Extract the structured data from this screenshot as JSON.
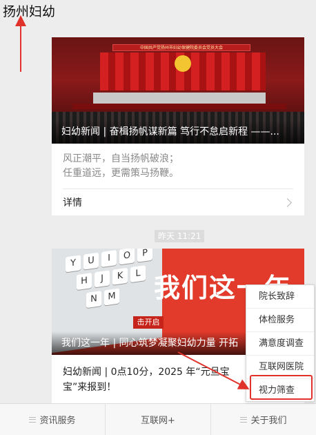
{
  "header": {
    "title": "扬州妇幼"
  },
  "cards": [
    {
      "caption": "妇幼新闻 | 奋楫扬帆谋新篇 笃行不怠启新程 ——...",
      "hero_banner": "中国共产党扬州市妇幼保健院委员会党员大会",
      "summary_lines": [
        "风正潮平，自当扬帆破浪；",
        "任重道远，更需策马扬鞭。"
      ],
      "detail_label": "详情"
    },
    {
      "caption": "我们这一年 | 同心筑梦凝聚妇幼力量 开拓",
      "hero_text": "我们这一年",
      "hero_tag": "击开启",
      "keys": [
        "Y",
        "U",
        "I",
        "O",
        "P",
        "H",
        "J",
        "K",
        "L",
        "N",
        "M"
      ],
      "body_lines": [
        "妇幼新闻 | 0点10分，2025 年“元旦宝",
        "宝”来报到！"
      ]
    }
  ],
  "timestamp": "昨天 11:21",
  "popup": {
    "items": [
      "院长致辞",
      "体检服务",
      "满意度调查",
      "互联网医院",
      "视力筛查"
    ]
  },
  "bottom_bar": {
    "tabs": [
      {
        "label": "资讯服务",
        "icon": "menu-icon"
      },
      {
        "label": "互联网+",
        "icon": ""
      },
      {
        "label": "关于我们",
        "icon": "menu-icon"
      }
    ]
  },
  "colors": {
    "annotation_red": "#e0312a",
    "hero2_red": "#e23b2c"
  }
}
